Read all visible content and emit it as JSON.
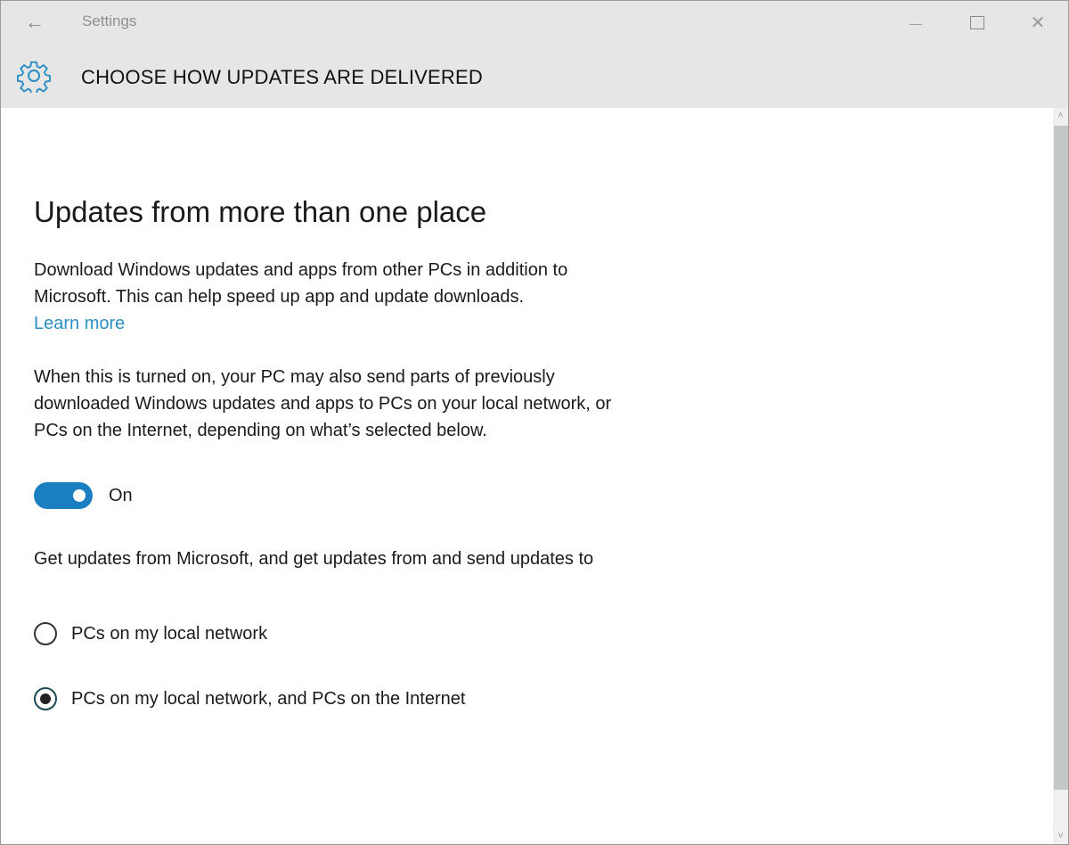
{
  "window": {
    "app_title": "Settings",
    "back_icon": "arrow-left-icon",
    "controls": {
      "minimize_icon": "minimize-icon",
      "maximize_icon": "maximize-icon",
      "close_icon": "close-icon",
      "close_glyph": "✕",
      "back_glyph": "←"
    }
  },
  "header": {
    "icon": "gear-icon",
    "title": "CHOOSE HOW UPDATES ARE DELIVERED",
    "accent_color": "#2b8fc4"
  },
  "main": {
    "section_title": "Updates from more than one place",
    "description": "Download Windows updates and apps from other PCs in addition to Microsoft. This can help speed up app and update downloads.",
    "learn_more": "Learn more",
    "info": "When this is turned on, your PC may also send parts of previously downloaded Windows updates and apps to PCs on your local network, or PCs on the Internet, depending on what’s selected below.",
    "toggle": {
      "state": "on",
      "label": "On",
      "color": "#1a7fc1"
    },
    "radio_prompt": "Get updates from Microsoft, and get updates from and send updates to",
    "options": [
      {
        "label": "PCs on my local network",
        "selected": false
      },
      {
        "label": "PCs on my local network, and PCs on the Internet",
        "selected": true
      }
    ]
  },
  "scrollbar": {
    "up_glyph": "˄",
    "down_glyph": "˅"
  }
}
